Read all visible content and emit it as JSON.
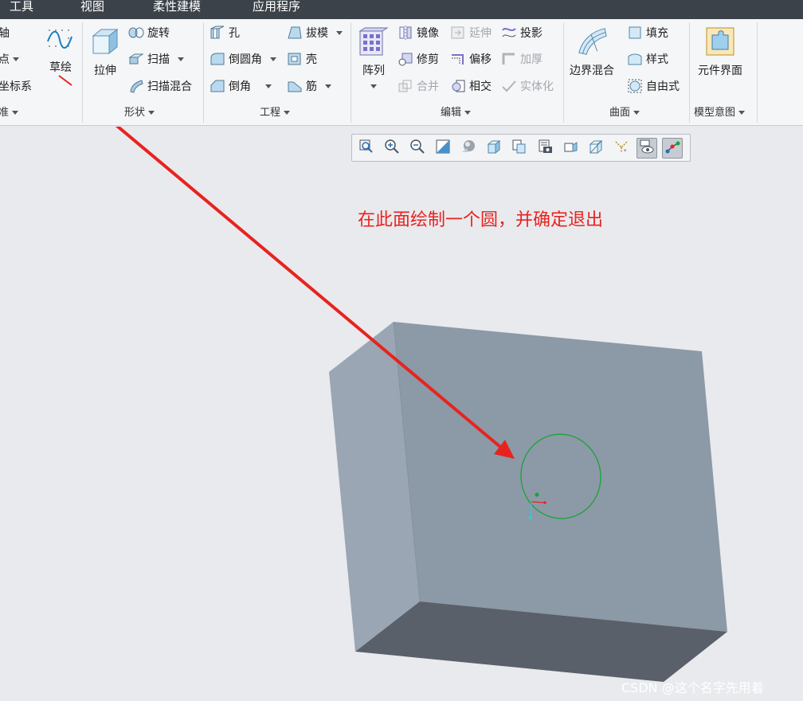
{
  "menu": {
    "items": [
      "工具",
      "视图",
      "柔性建模",
      "应用程序"
    ]
  },
  "ribbon": {
    "datum": {
      "items": [
        "轴",
        "点",
        "坐标系"
      ],
      "group_label": "准"
    },
    "sketch": {
      "label": "草绘"
    },
    "shapes": {
      "extrude": "拉伸",
      "revolve": "旋转",
      "sweep": "扫描",
      "swept_blend": "扫描混合",
      "group_label": "形状"
    },
    "engineering": {
      "hole": "孔",
      "round": "倒圆角",
      "chamfer": "倒角",
      "draft": "拔模",
      "shell": "壳",
      "rib": "筋",
      "group_label": "工程"
    },
    "editing": {
      "pattern": "阵列",
      "mirror": "镜像",
      "extend": "延伸",
      "project": "投影",
      "trim": "修剪",
      "offset": "偏移",
      "thicken": "加厚",
      "merge": "合并",
      "intersect": "相交",
      "solidify": "实体化",
      "group_label": "编辑"
    },
    "surfaces": {
      "boundary_blend": "边界混合",
      "fill": "填充",
      "style": "样式",
      "freestyle": "自由式",
      "group_label": "曲面"
    },
    "model_intent": {
      "component_interface": "元件界面",
      "group_label": "模型意图"
    }
  },
  "annotation": {
    "text": "在此面绘制一个圆，并确定退出"
  },
  "watermark": {
    "text": "CSDN @这个名字先用着"
  },
  "colors": {
    "menubar": "#3b4249",
    "ribbon": "#f5f6f8",
    "viewport": "#e9eaee",
    "annotation": "#e8231f",
    "box_front": "#8c99a7",
    "box_side": "#9aa6b3",
    "box_bottom": "#5a6069",
    "circle": "#1aa335"
  }
}
